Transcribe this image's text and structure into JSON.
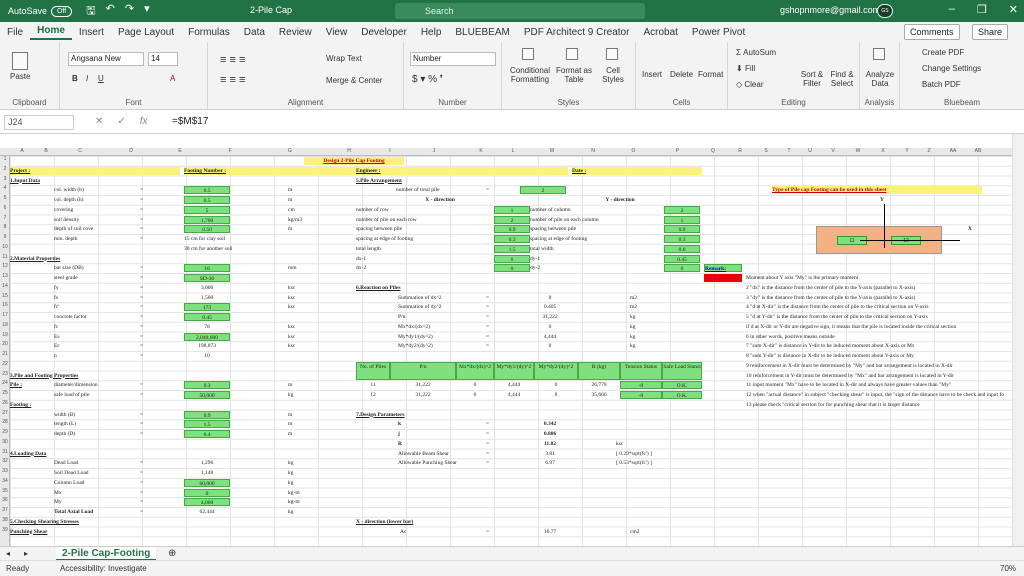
{
  "titlebar": {
    "autosave": "AutoSave",
    "toggle": "Off",
    "title": "2-Pile Cap",
    "search": "Search",
    "user": "gshopnmore@gmail.com",
    "avatar": "GS"
  },
  "tabs": [
    "File",
    "Home",
    "Insert",
    "Page Layout",
    "Formulas",
    "Data",
    "Review",
    "View",
    "Developer",
    "Help",
    "BLUEBEAM",
    "PDF Architect 9 Creator",
    "Acrobat",
    "Power Pivot"
  ],
  "ribbon": {
    "clipboard": {
      "paste": "Paste",
      "label": "Clipboard"
    },
    "font": {
      "name": "Angsana New",
      "size": "14",
      "label": "Font"
    },
    "alignment": {
      "wrap": "Wrap Text",
      "merge": "Merge & Center",
      "label": "Alignment"
    },
    "number": {
      "format": "Number",
      "label": "Number"
    },
    "styles": {
      "cond": "Conditional Formatting",
      "table": "Format as Table",
      "cell": "Cell Styles",
      "label": "Styles"
    },
    "cells": {
      "insert": "Insert",
      "delete": "Delete",
      "format": "Format",
      "label": "Cells"
    },
    "editing": {
      "autosum": "AutoSum",
      "fill": "Fill",
      "clear": "Clear",
      "sort": "Sort & Filter",
      "find": "Find & Select",
      "label": "Editing"
    },
    "analysis": {
      "analyze": "Analyze Data",
      "label": "Analysis"
    },
    "bluebeam": {
      "create": "Create PDF",
      "change": "Change Settings",
      "batch": "Batch PDF",
      "label": "Bluebeam"
    },
    "comments": "Comments",
    "share": "Share"
  },
  "formula": {
    "cell": "J24",
    "value": "=$M$17"
  },
  "columns": [
    "A",
    "B",
    "C",
    "D",
    "E",
    "F",
    "G",
    "H",
    "I",
    "J",
    "K",
    "L",
    "M",
    "N",
    "O",
    "P",
    "Q",
    "R",
    "S",
    "T",
    "U",
    "V",
    "W",
    "X",
    "Y",
    "Z",
    "AA",
    "AB"
  ],
  "sheet": {
    "title": "Design 2-Pile Cap Footing",
    "project": "Project :",
    "footing_number": "Footing Number :",
    "engineer": "Engineer :",
    "date": "Date :",
    "input_data": "1.Input Data",
    "inputs": [
      {
        "label": "col. width (b)",
        "value": "0.5",
        "unit": "m"
      },
      {
        "label": "col. depth (h)",
        "value": "0.5",
        "unit": "m"
      },
      {
        "label": "covering",
        "value": "5",
        "unit": "cm"
      },
      {
        "label": "soil density",
        "value": "1,700",
        "unit": "kg/m3"
      },
      {
        "label": "depth of soil cove",
        "value": "0.50",
        "unit": "m"
      },
      {
        "label": "min. depth",
        "value": "15 cm for clay soil",
        "unit": ""
      },
      {
        "label": "",
        "value": "30 cm for another soil",
        "unit": ""
      }
    ],
    "material": "2.Material Properties",
    "materials": [
      {
        "label": "bar size (DB)",
        "value": "16",
        "unit": "mm"
      },
      {
        "label": "steel grade",
        "value": "SD-30",
        "unit": ""
      },
      {
        "label": "fy",
        "value": "3,000",
        "unit": "ksc"
      },
      {
        "label": "fs",
        "value": "1,500",
        "unit": "ksc"
      },
      {
        "label": "fc'",
        "value": "173",
        "unit": "ksc"
      },
      {
        "label": "concrete factor",
        "value": "0.45",
        "unit": ""
      },
      {
        "label": "fc",
        "value": "78",
        "unit": "ksc"
      },
      {
        "label": "Es",
        "value": "2,040,000",
        "unit": "ksc"
      },
      {
        "label": "Ec",
        "value": "198,873",
        "unit": "ksc"
      },
      {
        "label": "n",
        "value": "10",
        "unit": ""
      }
    ],
    "pile_props": "3.Pile and Footing Properties",
    "pile_label": "Pile :",
    "piles": [
      {
        "label": "diameter/dimension",
        "value": "0.3",
        "unit": "m"
      },
      {
        "label": "safe load of pile",
        "value": "50,000",
        "unit": "kg"
      }
    ],
    "footing_label": "Footing :",
    "footing": [
      {
        "label": "width (B)",
        "value": "0.9",
        "unit": "m"
      },
      {
        "label": "length (L)",
        "value": "1.5",
        "unit": "m"
      },
      {
        "label": "depth (D)",
        "value": "0.4",
        "unit": "m"
      }
    ],
    "loading": "4.Loading Data",
    "loads": [
      {
        "label": "Dead Load",
        "value": "1,296",
        "unit": "kg"
      },
      {
        "label": "Soil Dead Load",
        "value": "1,148",
        "unit": "kg"
      },
      {
        "label": "Column Load",
        "value": "60,000",
        "unit": "kg"
      },
      {
        "label": "Mx",
        "value": "0",
        "unit": "kg-m"
      },
      {
        "label": "My",
        "value": "4,000",
        "unit": "kg-m"
      },
      {
        "label": "Total Axial Load",
        "value": "62,444",
        "unit": "kg"
      }
    ],
    "shear": "5.Checking Shearing Stresses",
    "punching": "Punching Shear",
    "pile_arr": "5.Pile Arrangement",
    "num_piles_label": "number of total pile",
    "num_piles": "2",
    "xdir": "X - direction",
    "ydir": "Y - direction",
    "arr_rows": [
      {
        "xl": "number of row",
        "xv": "1",
        "yl": "number of column",
        "yv": "2"
      },
      {
        "xl": "number of pile on each row",
        "xv": "2",
        "yl": "number of pile on each column",
        "yv": "1"
      },
      {
        "xl": "spacing between pile",
        "xv": "0.9",
        "yl": "spacing between pile",
        "yv": "0.9"
      },
      {
        "xl": "spacing at edge of footing",
        "xv": "0.3",
        "yl": "spacing at edge of footing",
        "yv": "0.3"
      },
      {
        "xl": "total length",
        "xv": "1.5",
        "yl": "total width",
        "yv": "0.6"
      },
      {
        "xl": "dx-1",
        "xv": "0",
        "yl": "dy-1",
        "yv": "0.45"
      },
      {
        "xl": "dx-2",
        "xv": "0",
        "yl": "dy-2",
        "yv": "0"
      }
    ],
    "reaction": "6.Reaction on Piles",
    "reactions": [
      {
        "label": "Summation of dx^2",
        "value": "0",
        "unit": "m2"
      },
      {
        "label": "Summation of dy^2",
        "value": "0.405",
        "unit": "m2"
      },
      {
        "label": "P/n",
        "value": "31,222",
        "unit": "kg"
      },
      {
        "label": "Mx*dx/(dx^2)",
        "value": "0",
        "unit": "kg"
      },
      {
        "label": "My*dy1/(dy^2)",
        "value": "4,444",
        "unit": "kg"
      },
      {
        "label": "My*dy2/(dy^2)",
        "value": "0",
        "unit": "kg"
      }
    ],
    "rtable_head": [
      "No. of Piles",
      "P/n",
      "Mx*dx/(dx)^2",
      "My*dy1/(dy)^2",
      "My*dy2/(dy)^2",
      "R (kg)",
      "Tension Status",
      "Safe Load Status"
    ],
    "rtable_rows": [
      [
        "11",
        "31,222",
        "0",
        "4,444",
        "0",
        "26,778",
        "-0",
        "O.K."
      ],
      [
        "12",
        "31,222",
        "0",
        "4,444",
        "0",
        "35,666",
        "-0",
        "O.K."
      ]
    ],
    "design": "7.Design Parameters",
    "params": [
      {
        "label": "k",
        "value": "0.342",
        "unit": ""
      },
      {
        "label": "j",
        "value": "0.886",
        "unit": ""
      },
      {
        "label": "R",
        "value": "11.82",
        "unit": "ksc"
      },
      {
        "label": "Allowable Beam Shear",
        "value": "3.81",
        "unit": "[ 0.29*sqrt(fc') ]"
      },
      {
        "label": "Allowable Punching Shear",
        "value": "6.97",
        "unit": "[ 0.53*sqrt(fc') ]"
      }
    ],
    "xlower": "X - direction (lower bar)",
    "ac_label": "Ac",
    "ac_value": "16.77",
    "ac_unit": "cm2",
    "diagram_title": "Type of Pile cap Footing can be used in this sheet",
    "d_x": "X",
    "d_y": "Y",
    "p11": "11",
    "p12": "12",
    "remark": "Remark:",
    "notes": [
      "Moment about Y axis \"My\" is the primary moment",
      "2 \"dx\" is the distance from the center of pile to the Y-axis (parallel to X-axis)",
      "3 \"dy\" is the distance from the center of pile to the Y-axis (parallel to X-axis)",
      "4 \"d at X-dir\" is the distance from the center of pile to the critical section on Y-axis",
      "5 \"d at Y-dir\" is the distance from the center of pile to the critical section on Y-axis",
      "  if d at X-dir or Y-dir are negative sign, it means that the pile is located inside the critical section",
      "6 in other words, positive means outside",
      "7 \"sum X-dir\" is distance in Y-dir to be induced moment about X-axis or Mx",
      "8 \"sum Y-dir\" is distance in X-dir to be induced moment about Y-axis or My",
      "9 reinforcement in X-dir must be determined by \"My\" and bar arrangement is located in X-dir",
      "10 reinforcement in Y-dir must be determined by \"Mx\" and bar arrangement is located in Y-dir",
      "11 input moment \"Mx\" have to be located in X-dir and always have greater values than \"My\"",
      "12 when \"actual distance\" in subject \"checking shear\" is input, the \"sign of the distance have to be check and input fo",
      "13 please check \"critical section for for punching shear that it is larger distance"
    ]
  },
  "sheettab": "2-Pile Cap-Footing",
  "status": {
    "ready": "Ready",
    "accessibility": "Accessibility: Investigate",
    "zoom": "70%"
  }
}
